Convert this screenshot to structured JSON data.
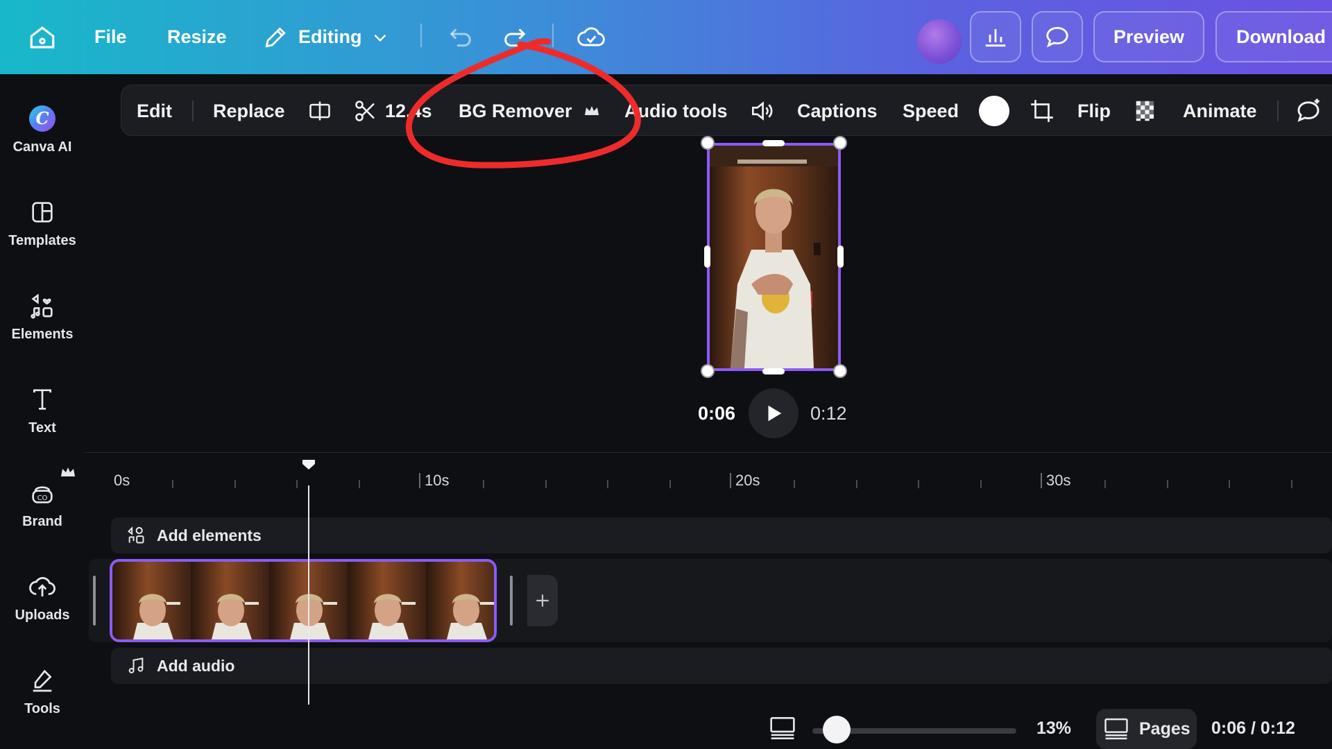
{
  "topbar": {
    "file": "File",
    "resize": "Resize",
    "editing": "Editing",
    "preview": "Preview",
    "download": "Download"
  },
  "sidebar": {
    "items": [
      {
        "label": "Canva AI",
        "icon": "canva-ai-icon"
      },
      {
        "label": "Templates",
        "icon": "templates-icon"
      },
      {
        "label": "Elements",
        "icon": "elements-icon"
      },
      {
        "label": "Text",
        "icon": "text-icon"
      },
      {
        "label": "Brand",
        "icon": "brand-icon"
      },
      {
        "label": "Uploads",
        "icon": "uploads-icon"
      },
      {
        "label": "Tools",
        "icon": "tools-icon"
      }
    ]
  },
  "context_toolbar": {
    "edit": "Edit",
    "replace": "Replace",
    "duration": "12.4s",
    "bg_remover": "BG Remover",
    "audio_tools": "Audio tools",
    "captions": "Captions",
    "speed": "Speed",
    "flip": "Flip",
    "animate": "Animate"
  },
  "player": {
    "current": "0:06",
    "total": "0:12"
  },
  "timeline": {
    "ruler": [
      "0s",
      "10s",
      "20s",
      "30s"
    ],
    "add_elements": "Add elements",
    "add_audio": "Add audio",
    "playhead_seconds": 6
  },
  "bottombar": {
    "zoom": "13%",
    "pages": "Pages",
    "time": "0:06 / 0:12",
    "zoom_fraction": 0.04
  },
  "colors": {
    "accent": "#8b5cf6",
    "annotation": "#ee2b2b",
    "background": "#0e0f13"
  }
}
